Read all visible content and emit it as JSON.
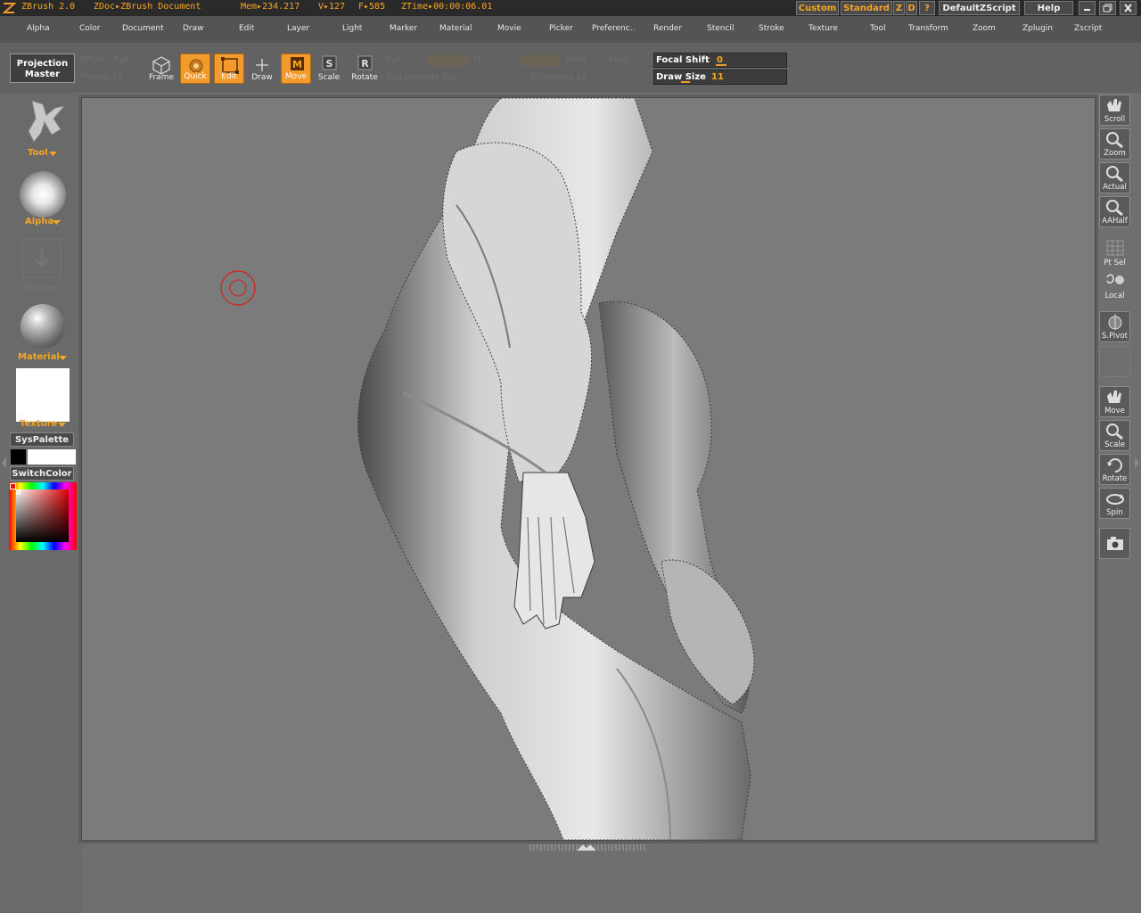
{
  "titlebar": {
    "app": "ZBrush 2.0",
    "doc": "ZDoc▸ZBrush Document",
    "mem": "Mem▸234.217",
    "verts": "V▸127",
    "faces": "F▸585",
    "ztime": "ZTime▸00:00:06.01",
    "custom": "Custom",
    "standard": "Standard",
    "z": "Z",
    "d": "D",
    "question": "?",
    "script": "DefaultZScript",
    "help": "Help"
  },
  "menu": [
    "Alpha",
    "Color",
    "Document",
    "Draw",
    "Edit",
    "Layer",
    "Light",
    "Marker",
    "Material",
    "Movie",
    "Picker",
    "Preferenc..",
    "Render",
    "Stencil",
    "Stroke",
    "Texture",
    "Tool",
    "Transform",
    "Zoom",
    "Zplugin",
    "Zscript"
  ],
  "shelf": {
    "projection_master_line1": "Projection",
    "projection_master_line2": "Master",
    "ghost": {
      "mrgb": "MRGB",
      "rgb": "Rgb",
      "m": "M",
      "zadd": "Zadd",
      "zsub": "Zsub",
      "frame_lbl": "PFrame 25",
      "rgb_intensity": "Rgb Intensity 100",
      "z_intensity": "Z Intensity 12"
    },
    "frame": "Frame",
    "quick": "Quick",
    "edit": "Edit",
    "draw": "Draw",
    "move": "Move",
    "scale": "Scale",
    "rotate": "Rotate",
    "focal_shift_label": "Focal Shift",
    "focal_shift_value": "0",
    "draw_size_label": "Draw Size",
    "draw_size_value": "11"
  },
  "left": {
    "tool": "Tool",
    "alpha": "Alpha",
    "stroke": "Stroke",
    "material": "Material",
    "texture": "Texture",
    "syspalette": "SysPalette",
    "switchcolor": "SwitchColor",
    "primary_color": "#000000",
    "secondary_color": "#ffffff"
  },
  "right": {
    "scroll": "Scroll",
    "zoom": "Zoom",
    "actual": "Actual",
    "aahalf": "AAHalf",
    "ptsel": "Pt Sel",
    "local": "Local",
    "spivot": "S.Pivot",
    "move": "Move",
    "scale": "Scale",
    "rotate": "Rotate",
    "spin": "Spin"
  },
  "colors": {
    "accent": "#f39a2c",
    "cursor": "#d22222"
  }
}
